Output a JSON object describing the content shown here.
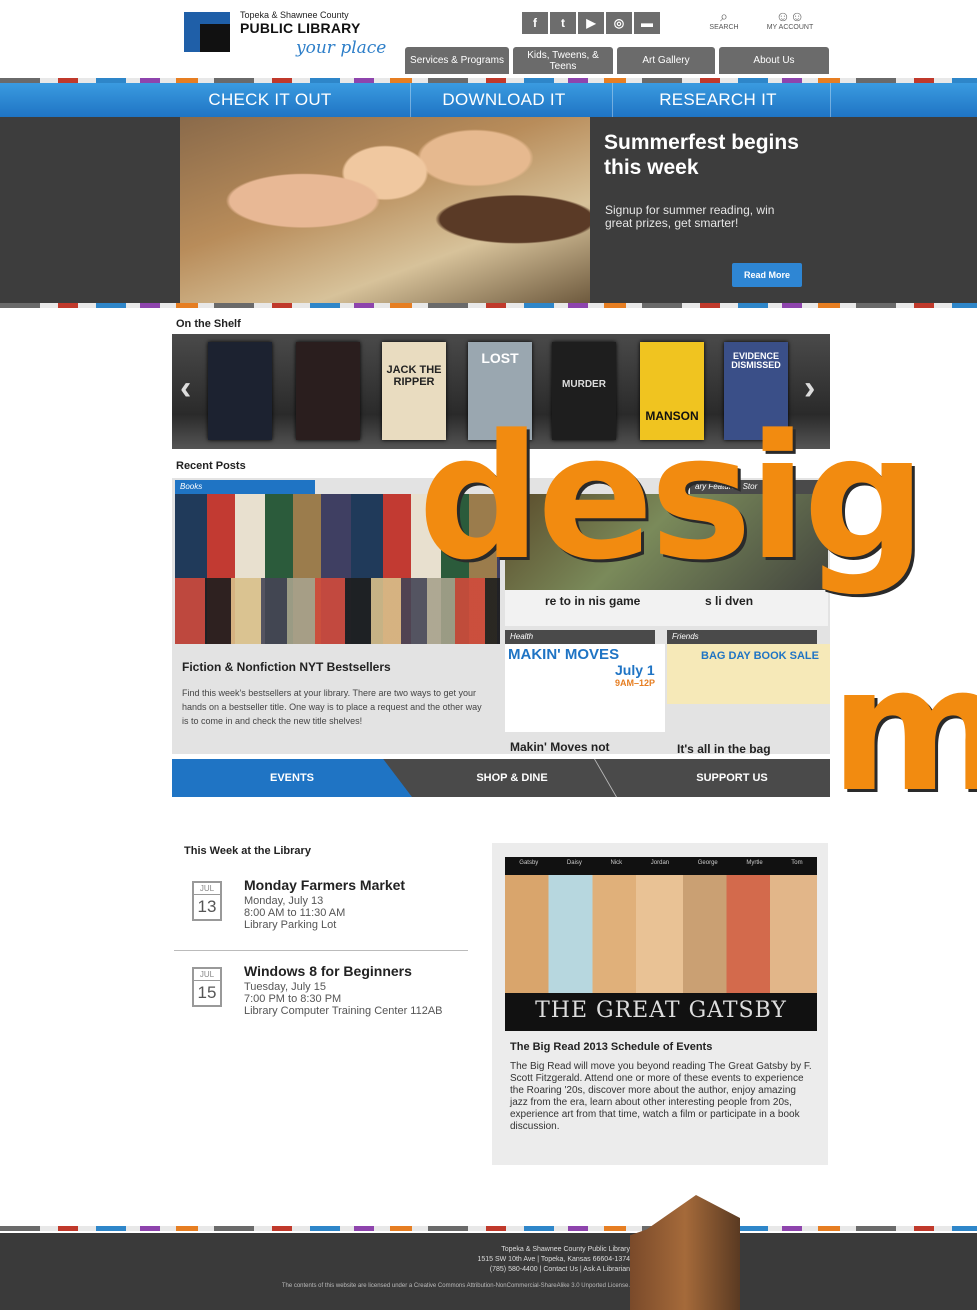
{
  "header": {
    "logo_sub": "Topeka & Shawnee County",
    "logo_main": "PUBLIC LIBRARY",
    "logo_tag": "your place",
    "social": [
      "f",
      "t",
      "▶",
      "◎",
      "▬"
    ],
    "search_label": "SEARCH",
    "account_label": "MY ACCOUNT",
    "nav": [
      "Services & Programs",
      "Kids, Tweens, & Teens",
      "Art Gallery",
      "About Us"
    ]
  },
  "mainnav": [
    "CHECK IT OUT",
    "DOWNLOAD IT",
    "RESEARCH IT"
  ],
  "hero": {
    "title": "Summerfest begins this week",
    "text": "Signup for summer reading, win great prizes, get smarter!",
    "button": "Read More"
  },
  "shelf": {
    "label": "On the Shelf",
    "books": [
      {
        "title": "",
        "color": "#1c2230"
      },
      {
        "title": "",
        "color": "#2a1e1e"
      },
      {
        "title": "JACK THE RIPPER",
        "color": "#e9dcc0"
      },
      {
        "title": "LOST",
        "color": "#9aa7b0"
      },
      {
        "title": "MURDER",
        "color": "#1e1e1e"
      },
      {
        "title": "MANSON",
        "color": "#f0c420"
      },
      {
        "title": "EVIDENCE DISMISSED",
        "color": "#3a4f88"
      }
    ]
  },
  "posts": {
    "label": "Recent Posts",
    "books_tag": "Books",
    "featured_tag": "ary Featured Stor",
    "main_title": "Fiction & Nonfiction NYT Bestsellers",
    "main_body": "Find this week's bestsellers at your library. There are two ways to get your hands on a bestseller title. One way is to place a request and the other way is to come in and check the new title shelves!",
    "feat_caption1": "re to in nis game",
    "feat_caption2": "s li dven",
    "health_tag": "Health",
    "health_img_text": "MAKIN' MOVES",
    "health_date": "July 1",
    "health_time": "9AM–12P",
    "health_title": "Makin' Moves not waves",
    "friends_tag": "Friends",
    "friends_img_text": "BAG DAY BOOK SALE",
    "friends_title": "It's all in the bag"
  },
  "tabs": [
    "EVENTS",
    "SHOP & DINE",
    "SUPPORT US"
  ],
  "events": {
    "label": "This Week at the Library",
    "items": [
      {
        "month": "JUL",
        "day": "13",
        "title": "Monday Farmers Market",
        "date": "Monday, July 13",
        "time": "8:00 AM to 11:30 AM",
        "place": "Library Parking Lot"
      },
      {
        "month": "JUL",
        "day": "15",
        "title": "Windows 8 for Beginners",
        "date": "Tuesday, July 15",
        "time": "7:00 PM to 8:30 PM",
        "place": "Library Computer Training Center 112AB"
      }
    ]
  },
  "bigread": {
    "names": [
      "Gatsby",
      "Daisy",
      "Nick",
      "Jordan",
      "George",
      "Myrtle",
      "Tom"
    ],
    "cover_title": "THE GREAT GATSBY",
    "title": "The Big Read 2013 Schedule of Events",
    "body": "The Big Read will move you beyond reading The Great Gatsby by F. Scott Fitzgerald. Attend one or more of these events to experience the Roaring '20s, discover more about the author, enjoy amazing jazz from the era, learn about other interesting people from 20s, experience art from that time, watch a film or participate in a book discussion."
  },
  "watermark": {
    "line1": "desig",
    "line2": "m"
  },
  "footer": {
    "line1": "Topeka & Shawnee County Public Library",
    "line2": "1515 SW 10th Ave | Topeka, Kansas 66604-1374",
    "line3": "(785) 580-4400 | Contact Us | Ask A Librarian",
    "license": "The contents of this website are licensed under a Creative Commons Attribution-NonCommercial-ShareAlike 3.0 Unported License."
  }
}
